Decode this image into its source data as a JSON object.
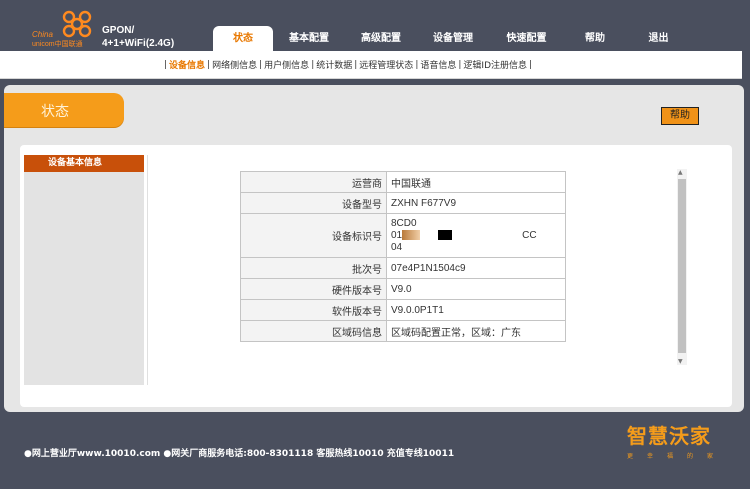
{
  "logo": {
    "line1": "China",
    "line2": "unicom中国联通"
  },
  "model": {
    "line1": "GPON/",
    "line2": "4+1+WiFi(2.4G)"
  },
  "nav": [
    "状态",
    "基本配置",
    "高级配置",
    "设备管理",
    "快速配置",
    "帮助",
    "退出"
  ],
  "subnav": [
    "设备信息",
    "网络侧信息",
    "用户侧信息",
    "统计数据",
    "远程管理状态",
    "语音信息",
    "逻辑ID注册信息"
  ],
  "section_title": "状态",
  "help_button": "帮助",
  "sidebar": {
    "active": "设备基本信息"
  },
  "info": {
    "operator_label": "运营商",
    "operator_value": "中国联通",
    "model_label": "设备型号",
    "model_value": "ZXHN F677V9",
    "id_label": "设备标识号",
    "id_line1": "8CD0",
    "id_line2": "01",
    "id_line2_tail": "CC",
    "id_line3": "04",
    "batch_label": "批次号",
    "batch_value": "07e4P1N1504c9",
    "hw_label": "硬件版本号",
    "hw_value": "V9.0",
    "sw_label": "软件版本号",
    "sw_value": "V9.0.0P1T1",
    "area_label": "区域码信息",
    "area_value": "区域码配置正常，区域：广东"
  },
  "footer": "●网上营业厅www.10010.com ●网关厂商服务电话:800-8301118 客服热线10010 充值专线10011",
  "brand": {
    "big": "智慧沃家",
    "small": "更幸福的家"
  },
  "colors": {
    "accent": "#f59c1a",
    "sidebar_active": "#c8500a",
    "header_bg": "#4a4f5e"
  }
}
